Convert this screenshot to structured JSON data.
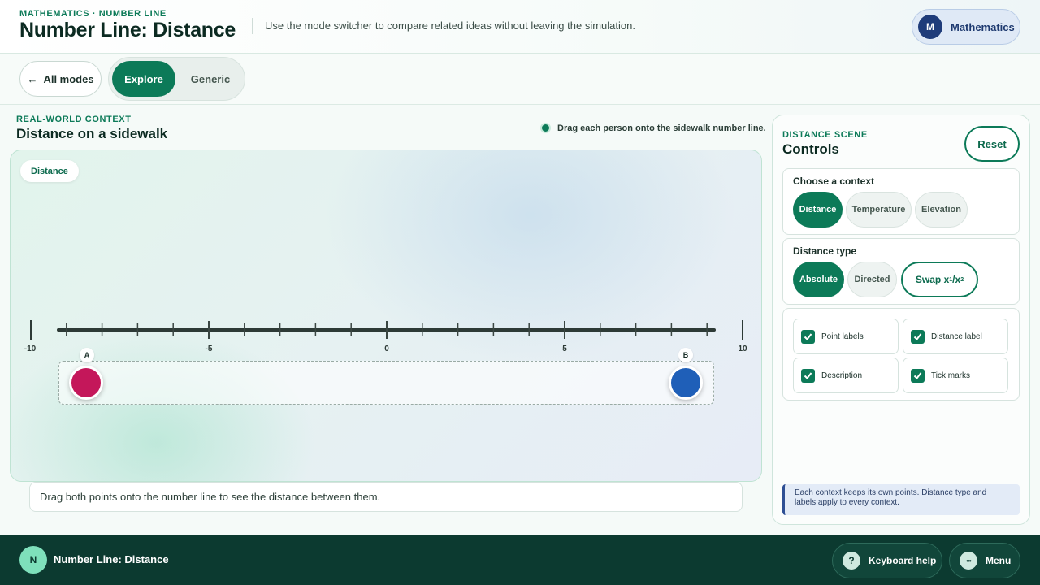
{
  "header": {
    "eyebrow": "MATHEMATICS · NUMBER LINE",
    "title": "Number Line: Distance",
    "description": "Use the mode switcher to compare related ideas without leaving the simulation.",
    "subject_initial": "M",
    "subject_name": "Mathematics"
  },
  "modebar": {
    "back_arrow": "←",
    "back_label": "All modes",
    "modes": [
      {
        "label": "Explore",
        "active": true
      },
      {
        "label": "Generic",
        "active": false
      }
    ]
  },
  "scene": {
    "eyebrow": "REAL-WORLD CONTEXT",
    "title": "Distance on a sidewalk",
    "hint": "Drag each person onto the sidewalk number line.",
    "context_badge": "Distance",
    "number_line": {
      "min": -10,
      "max": 10,
      "labels": [
        "-10",
        "-5",
        "0",
        "5",
        "10"
      ]
    },
    "points": [
      {
        "label": "A",
        "color": "#c4175a"
      },
      {
        "label": "B",
        "color": "#1f5fb8"
      }
    ],
    "description": "Drag both points onto the number line to see the distance between them."
  },
  "controls": {
    "eyebrow": "DISTANCE SCENE",
    "title": "Controls",
    "reset_label": "Reset",
    "context": {
      "title": "Choose a context",
      "options": [
        "Distance",
        "Temperature",
        "Elevation"
      ],
      "selected": "Distance"
    },
    "distance_type": {
      "title": "Distance type",
      "options": [
        "Absolute",
        "Directed"
      ],
      "selected": "Absolute",
      "swap_label": "Swap x",
      "swap_sub1": "1",
      "swap_slash": "/x",
      "swap_sub2": "2"
    },
    "toggles": [
      {
        "label": "Point labels",
        "checked": true
      },
      {
        "label": "Distance label",
        "checked": true
      },
      {
        "label": "Description",
        "checked": true
      },
      {
        "label": "Tick marks",
        "checked": true
      }
    ],
    "note": "Each context keeps its own points. Distance type and labels apply to every context."
  },
  "footer": {
    "initial": "N",
    "title": "Number Line: Distance",
    "help_icon": "?",
    "help_label": "Keyboard help",
    "menu_icon": "•••",
    "menu_label": "Menu"
  },
  "colors": {
    "accent": "#0c7a58",
    "footer_bg": "#0c3a30",
    "subject": "#1f3c7a"
  }
}
